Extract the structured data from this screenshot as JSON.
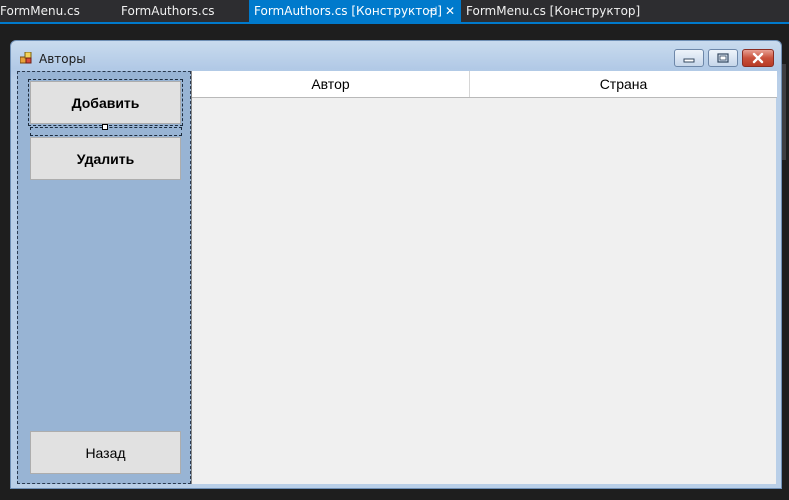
{
  "tabs": [
    {
      "label": "FormMenu.cs",
      "active": false
    },
    {
      "label": "FormAuthors.cs",
      "active": false
    },
    {
      "label": "FormAuthors.cs [Конструктор]",
      "active": true
    },
    {
      "label": "FormMenu.cs [Конструктор]",
      "active": false
    }
  ],
  "tab_glyphs": {
    "pin": "⊣",
    "close": "✕"
  },
  "form": {
    "title": "Авторы",
    "buttons": {
      "add": "Добавить",
      "delete": "Удалить",
      "back": "Назад"
    },
    "grid": {
      "columns": [
        "Автор",
        "Страна"
      ]
    }
  },
  "colors": {
    "accent": "#007acc",
    "panel": "#98b4d4",
    "ide_bg": "#1e1e1e"
  },
  "icons": [
    "form-app-icon",
    "minimize-icon",
    "maximize-icon",
    "close-icon",
    "pin-icon",
    "tab-close-icon"
  ]
}
